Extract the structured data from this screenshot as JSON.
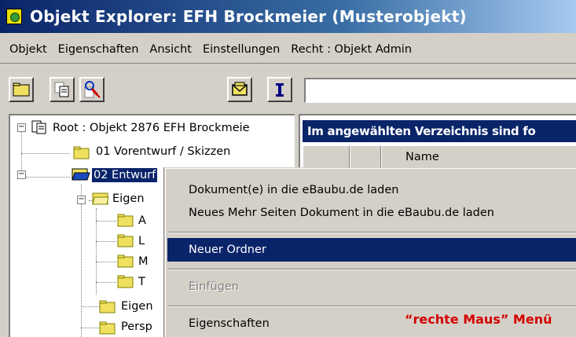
{
  "window": {
    "title": "Objekt Explorer: EFH Brockmeier (Musterobjekt)",
    "icon": "object-explorer-icon"
  },
  "menubar": {
    "items": [
      {
        "label": "Objekt"
      },
      {
        "label": "Eigenschaften"
      },
      {
        "label": "Ansicht"
      },
      {
        "label": "Einstellungen"
      },
      {
        "label": "Recht : Objekt Admin"
      }
    ]
  },
  "toolbar": {
    "buttons": [
      {
        "icon": "folder-icon"
      },
      {
        "icon": "copy-documents-icon"
      },
      {
        "icon": "search-people-icon"
      },
      {
        "icon": "mail-icon"
      },
      {
        "icon": "text-cursor-icon"
      }
    ],
    "search_value": ""
  },
  "tree": {
    "root": "Root : Objekt 2876 EFH Brockmeie",
    "items": [
      {
        "label": "01 Vorentwurf / Skizzen"
      },
      {
        "label": "02 Entwurf",
        "selected": true
      },
      {
        "label": "Eigen"
      },
      {
        "label": "A"
      },
      {
        "label": "L"
      },
      {
        "label": "M"
      },
      {
        "label": "T"
      },
      {
        "label": "Eigen"
      },
      {
        "label": "Persp"
      }
    ]
  },
  "list": {
    "caption": "Im angewählten Verzeichnis sind fo",
    "columns": [
      "",
      "",
      "Name"
    ]
  },
  "context_menu": {
    "items": [
      {
        "label": "Dokument(e) in die eBaubu.de laden"
      },
      {
        "label": "Neues Mehr Seiten Dokument in die eBaubu.de laden"
      },
      {
        "label": "Neuer Ordner",
        "highlighted": true
      },
      {
        "label": "Einfügen",
        "disabled": true
      },
      {
        "label": "Eigenschaften"
      }
    ],
    "annotation": "“rechte Maus” Menü",
    "annotation_color": "#d40000"
  },
  "colors": {
    "selection": "#0a246a",
    "face": "#d4d0c8"
  }
}
